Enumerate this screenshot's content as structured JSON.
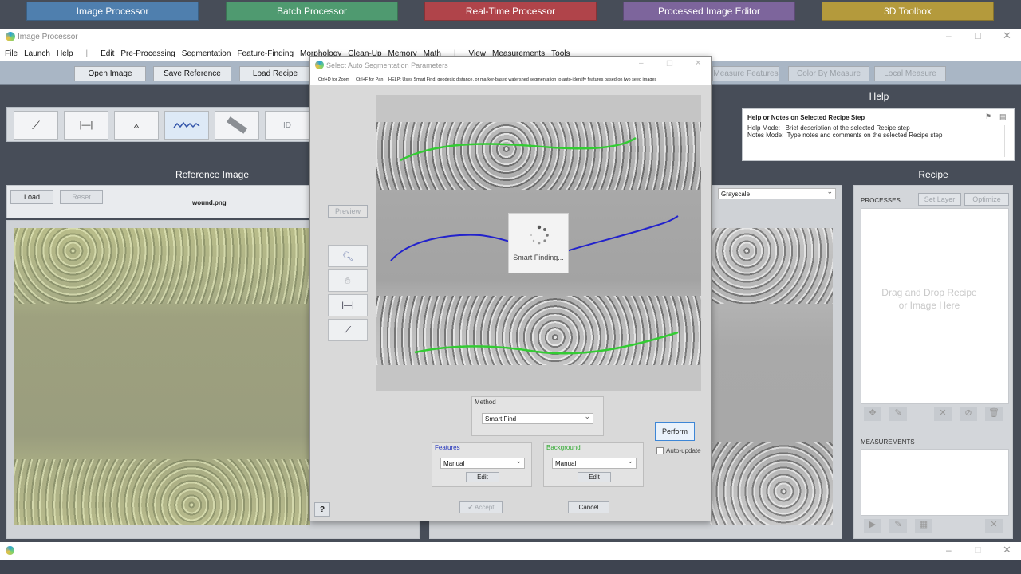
{
  "top_apps": [
    {
      "label": "Image Processor",
      "color": "#4f7fae"
    },
    {
      "label": "Batch Processor",
      "color": "#4f9a70"
    },
    {
      "label": "Real-Time Processor",
      "color": "#b0444a"
    },
    {
      "label": "Processed Image Editor",
      "color": "#7d659c"
    },
    {
      "label": "3D Toolbox",
      "color": "#b49a3c"
    }
  ],
  "window": {
    "title": "Image Processor"
  },
  "menu": {
    "items": [
      "File",
      "Launch",
      "Help",
      "|",
      "Edit",
      "Pre-Processing",
      "Segmentation",
      "Feature-Finding",
      "Morphology",
      "Clean-Up",
      "Memory",
      "Math",
      "|",
      "View",
      "Measurements",
      "Tools"
    ]
  },
  "toolbar": {
    "open_image": "Open Image",
    "save_reference": "Save Reference",
    "load_recipe": "Load Recipe",
    "measure_features": "Measure Features",
    "color_by_measure": "Color By Measure",
    "local_measure": "Local Measure"
  },
  "tools": {
    "id_label": "ID"
  },
  "reference": {
    "title": "Reference Image",
    "load": "Load",
    "reset": "Reset",
    "filename": "wound.png"
  },
  "processed": {
    "mode": "Grayscale"
  },
  "help_panel": {
    "title": "Help",
    "header": "Help or Notes on Selected Recipe Step",
    "line1": "Help Mode:   Brief description of the selected Recipe step",
    "line2": "Notes Mode:  Type notes and comments on the selected Recipe step"
  },
  "recipe": {
    "title": "Recipe",
    "processes": "PROCESSES",
    "set_layer": "Set Layer",
    "optimize": "Optimize",
    "drop_line1": "Drag and Drop Recipe",
    "drop_line2": "or Image Here",
    "measurements": "MEASUREMENTS"
  },
  "dialog": {
    "title": "Select Auto Segmentation Parameters",
    "hint1": "Ctrl+D for Zoom",
    "hint2": "Ctrl+F for Pan",
    "help_text": "HELP:  Uses Smart Find, geodesic distance, or marker-based watershed segmentation to auto-identify features based on two seed images",
    "preview": "Preview",
    "spinner_text": "Smart Finding...",
    "method_label": "Method",
    "method_value": "Smart Find",
    "features_label": "Features",
    "features_value": "Manual",
    "features_edit": "Edit",
    "background_label": "Background",
    "background_value": "Manual",
    "background_edit": "Edit",
    "perform": "Perform",
    "auto_update": "Auto-update",
    "accept": "✔ Accept",
    "cancel": "Cancel",
    "question": "?"
  },
  "colors": {
    "feature_line": "#2222cc",
    "background_line": "#33cc33"
  }
}
